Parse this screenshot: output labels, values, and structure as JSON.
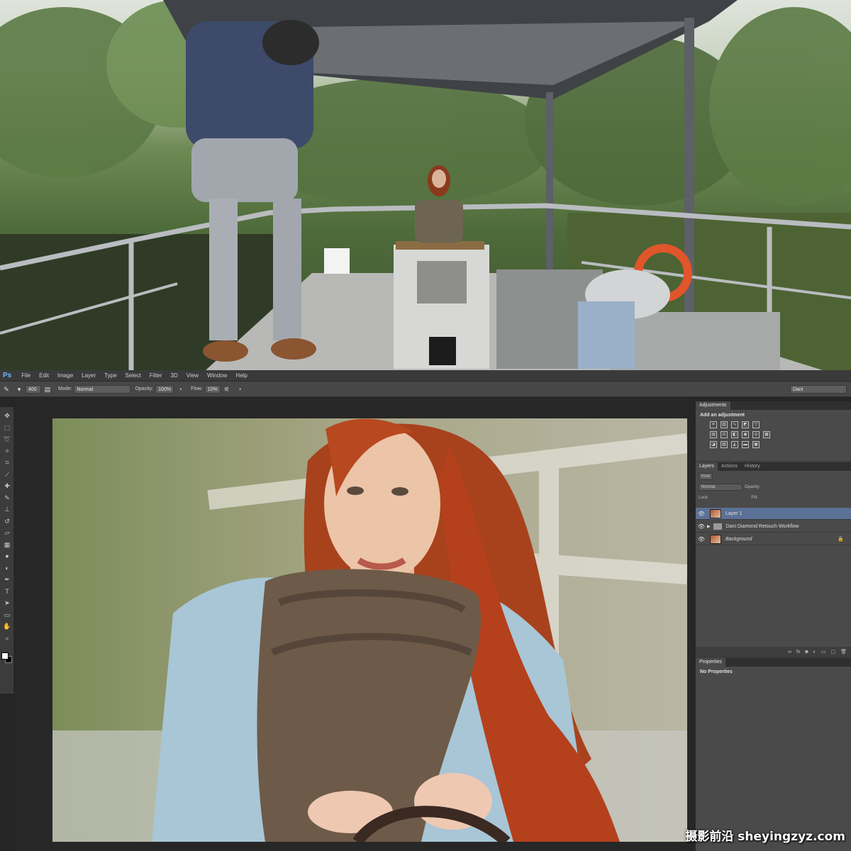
{
  "photo": {
    "top_alt_visible": false
  },
  "menubar": {
    "logo": "Ps",
    "items": [
      "File",
      "Edit",
      "Image",
      "Layer",
      "Type",
      "Select",
      "Filter",
      "3D",
      "View",
      "Window",
      "Help"
    ]
  },
  "options": {
    "brush_size": "400",
    "mode_label": "Mode:",
    "mode_value": "Normal",
    "opacity_label": "Opacity:",
    "opacity_value": "100%",
    "flow_label": "Flow:",
    "flow_value": "10%",
    "workspace": "Dani"
  },
  "panels": {
    "adjustments": {
      "tab": "Adjustments",
      "title": "Add an adjustment"
    },
    "layers": {
      "tabs": [
        "Layers",
        "Actions",
        "History"
      ],
      "kind": "Kind",
      "blend": "Normal",
      "opacity_label": "Opacity:",
      "lock_label": "Lock:",
      "fill_label": "Fill:",
      "rows": [
        {
          "name": "Layer 1",
          "selected": true,
          "type": "layer"
        },
        {
          "name": "Dani Diamond Retouch Workflow",
          "selected": false,
          "type": "group"
        },
        {
          "name": "Background",
          "selected": false,
          "type": "layer",
          "locked": true
        }
      ]
    },
    "properties": {
      "tab": "Properties",
      "text": "No Properties"
    }
  },
  "watermark": "摄影前沿 sheyingzyz.com",
  "colors": {
    "ui_dark": "#3c3c3c",
    "selection": "#5b7196",
    "hair": "#b5401c"
  }
}
